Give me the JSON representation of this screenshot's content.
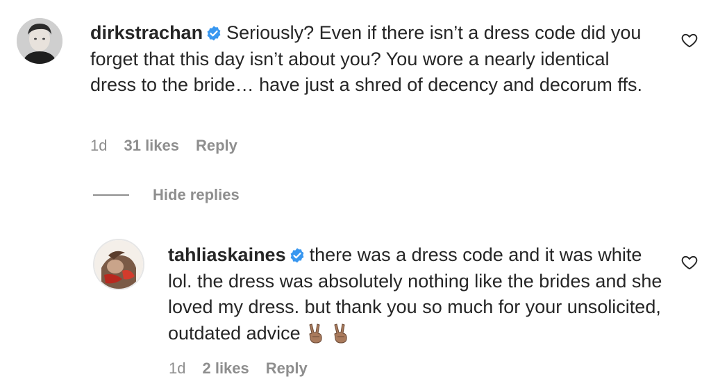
{
  "comments": [
    {
      "username": "dirkstrachan",
      "text": "Seriously? Even if there isn’t a dress code did you forget that this day isn’t about you? You wore a nearly identical dress to the bride… have just a shred of decency and decorum ffs.",
      "time": "1d",
      "likes": "31 likes",
      "reply_label": "Reply"
    }
  ],
  "hide_replies_label": "Hide replies",
  "replies": [
    {
      "username": "tahliaskaines",
      "text": "there was a dress code and it was white lol. the dress was absolutely nothing like the brides and she loved my dress. but thank you so much for your unsolicited, outdated advice",
      "time": "1d",
      "likes": "2 likes",
      "reply_label": "Reply"
    }
  ],
  "icons": {
    "verified": "verified-badge-icon",
    "heart": "heart-outline-icon",
    "emoji": "victory-hand-emoji"
  },
  "colors": {
    "verified": "#3897f0",
    "text": "#262626",
    "secondary": "#8e8e8e"
  }
}
